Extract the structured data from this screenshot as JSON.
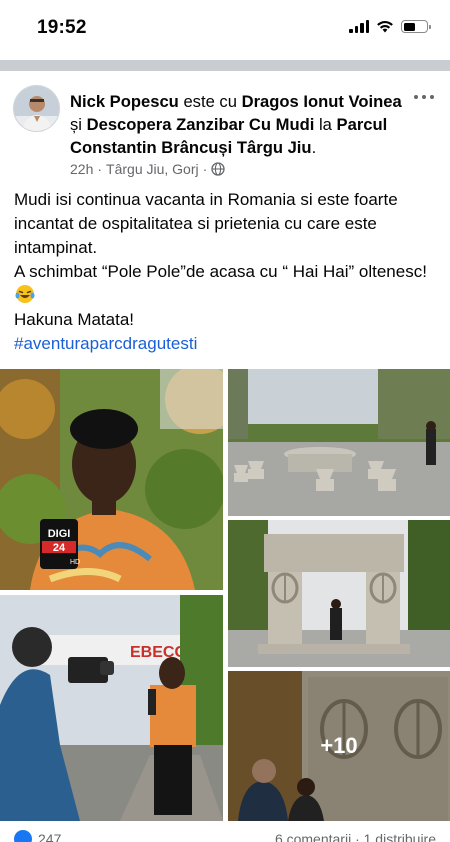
{
  "status_bar": {
    "time": "19:52"
  },
  "post": {
    "author": "Nick Popescu",
    "with_word": "este cu",
    "tagged_person": "Dragos Ionut Voinea",
    "conjunction": "și",
    "tagged_page": "Descopera Zanzibar Cu Mudi",
    "at_word": "la",
    "location": "Parcul Constantin Brâncuși Târgu Jiu",
    "period": ".",
    "time_ago": "22h",
    "separator": "·",
    "place": "Târgu Jiu, Gorj",
    "dot": "·",
    "text_lines": [
      "Mudi isi continua vacanta in Romania si este foarte incantat de ospitalitatea si prietenia cu care este intampinat.",
      "A schimbat “Pole Pole”de acasa cu  “ Hai Hai” oltenesc!",
      "Hakuna Matata!"
    ],
    "hashtag": "#aventuraparcdragutesti",
    "emoji_icon": "laughing-tears-emoji-icon",
    "more_photos": "+10",
    "mic_brand": "DIGI 24",
    "mic_brand_line1": "DIGI",
    "mic_brand_line2": "24",
    "mic_hd": "HD",
    "building_sign": "EBECC",
    "reactions_count": "247",
    "comments_shares": "6 comentarii · 1 distribuire"
  },
  "colors": {
    "link": "#1b5fd6",
    "meta": "#65676b",
    "divider": "#c9ccd1",
    "like": "#1877f2"
  }
}
